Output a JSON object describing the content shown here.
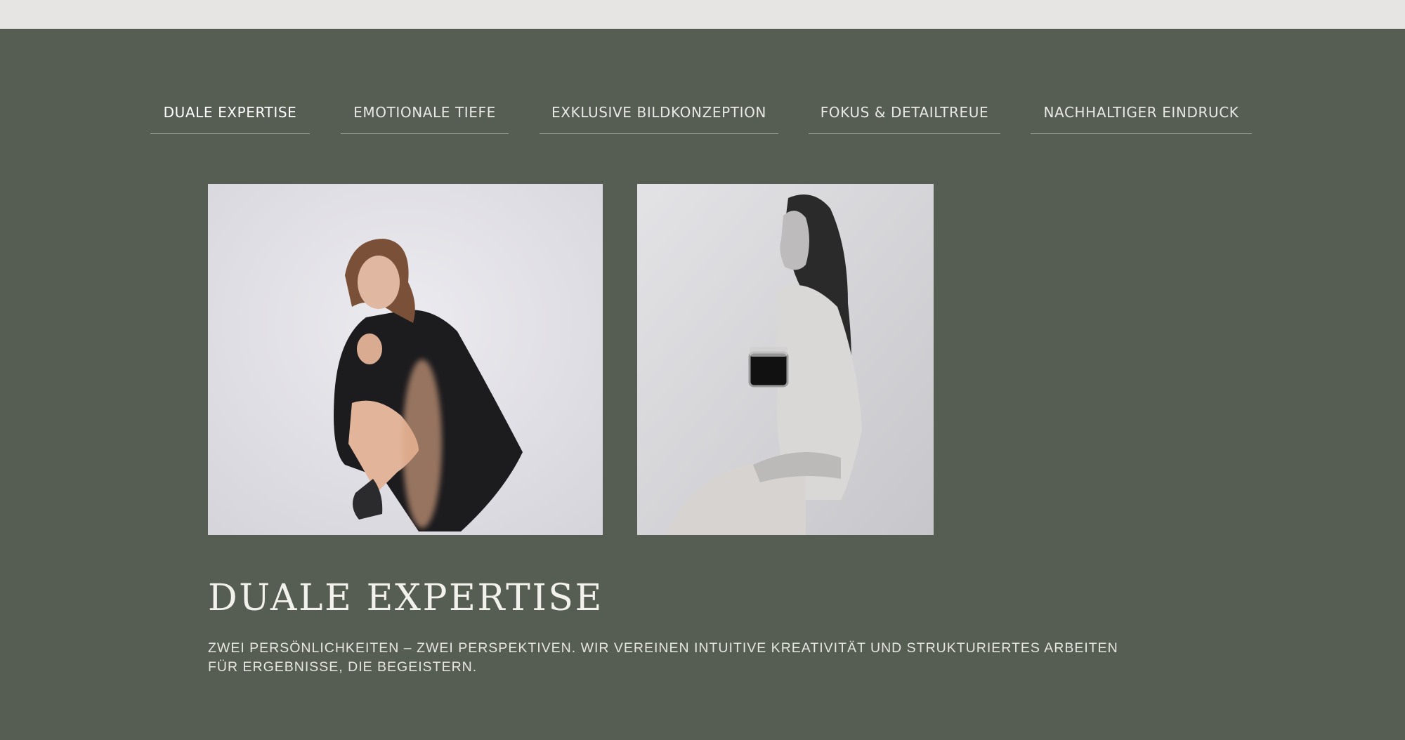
{
  "tabs": [
    {
      "label": "DUALE EXPERTISE",
      "active": true
    },
    {
      "label": "EMOTIONALE TIEFE",
      "active": false
    },
    {
      "label": "EXKLUSIVE BILDKONZEPTION",
      "active": false
    },
    {
      "label": "FOKUS & DETAILTREUE",
      "active": false
    },
    {
      "label": "NACHHALTIGER EINDRUCK",
      "active": false
    }
  ],
  "section": {
    "title": "DUALE EXPERTISE",
    "description": "ZWEI PERSÖNLICHKEITEN – ZWEI PERSPEKTIVEN. WIR VEREINEN INTUITIVE KREATIVITÄT UND STRUKTURIERTES ARBEITEN FÜR ERGEBNISSE, DIE BEGEISTERN."
  },
  "colors": {
    "background": "#565d53",
    "topbar": "#e6e5e3",
    "text": "#e8e8e4"
  }
}
